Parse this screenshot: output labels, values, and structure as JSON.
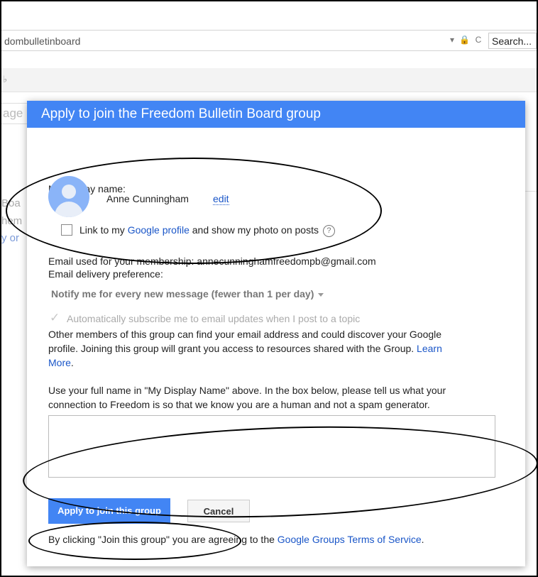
{
  "browser": {
    "url_fragment": "dombulletinboard",
    "address_icons": "▾ 🔒 C",
    "search_placeholder": "Search..."
  },
  "background": {
    "top_strip_glyph": "♭",
    "search_hint": "age",
    "side_text_1": "Boa",
    "side_text_2": "hem",
    "side_text_3": "y or"
  },
  "dialog": {
    "title": "Apply to join the Freedom Bulletin Board group",
    "display_name_label": "My display name:",
    "display_name_value": "Anne Cunningham",
    "edit_link": "edit",
    "profile_link_prefix": "Link to my",
    "profile_link_text": "Google profile",
    "profile_link_suffix": "and show my photo on posts",
    "help_icon": "?",
    "membership_email_text": "Email used for your membership: annecunninghamfreedompb@gmail.com",
    "delivery_preference_label": "Email delivery preference:",
    "delivery_preference_value": "Notify me for every new message (fewer than 1 per day)",
    "auto_subscribe_label": "Automatically subscribe me to email updates when I post to a topic",
    "visibility_notice_1": "Other members of this group can find your email address and could discover your Google",
    "visibility_notice_2": "profile. Joining this group will grant you access to resources shared with the Group.",
    "learn_more_1": "Learn",
    "learn_more_2": "More",
    "visibility_notice_end": ".",
    "instructions_1": "Use your full name in \"My Display Name\" above. In the box below, please tell us what your",
    "instructions_2": "connection to Freedom is so that we know you are a human and not a spam generator.",
    "connection_value": "",
    "apply_button": "Apply to join this group",
    "cancel_button": "Cancel",
    "terms_prefix": "By clicking \"Join this group\" you are agreeing to the",
    "terms_link": "Google Groups Terms of Service",
    "terms_suffix": "."
  },
  "colors": {
    "accent": "#4285f4",
    "link": "#1a56c8"
  }
}
